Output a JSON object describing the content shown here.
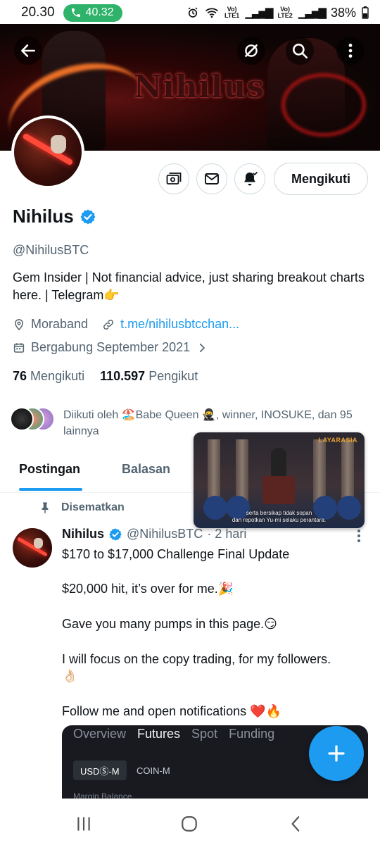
{
  "status_bar": {
    "time": "20.30",
    "call_timer": "40.32",
    "sim1": "Vo) LTE1",
    "sim2": "Vo) LTE2",
    "battery": "38%"
  },
  "header": {
    "banner_title": "Nihilus",
    "icons": [
      "back-arrow-icon",
      "grok-icon",
      "search-icon",
      "more-vertical-icon"
    ]
  },
  "profile": {
    "name": "Nihilus",
    "handle": "@NihilusBTC",
    "bio": "Gem Insider | Not financial advice, just sharing breakout charts here. | Telegram👉",
    "location": "Moraband",
    "website": "t.me/nihilusbtcchan...",
    "joined": "Bergabung September 2021",
    "following_count": "76",
    "following_label": "Mengikuti",
    "followers_count": "110.597",
    "followers_label": "Pengikut",
    "followed_by": "Diikuti oleh 🏖️Babe Queen 🥷, winner, INOSUKE, dan 95 lainnya",
    "follow_button": "Mengikuti",
    "verified_color": "#1d9bf0"
  },
  "tabs": [
    {
      "label": "Postingan",
      "active": true
    },
    {
      "label": "Balasan",
      "active": false
    }
  ],
  "pip_video": {
    "channel": "LAYARASIA",
    "subtitle_line1": "serta bersikap tidak sopan",
    "subtitle_line2": "dan repotkan Yu-mi selaku perantara."
  },
  "pinned_tweet": {
    "pinned_label": "Disematkan",
    "author": "Nihilus",
    "handle": "@NihilusBTC",
    "time": "· 2 hari",
    "lines": [
      "$170 to $17,000 Challenge Final Update",
      "$20,000 hit, it’s over for me.🎉",
      "Gave you many pumps in this page.😏",
      "I will focus on the copy trading, for my followers.",
      "👌🏻",
      "Follow me and open notifications ❤️🔥"
    ],
    "image": {
      "tabs": [
        "Overview",
        "Futures",
        "Spot",
        "Funding"
      ],
      "active_tab": "Futures",
      "pill_active": "USDⓈ-M",
      "pill_inactive": "COIN-M",
      "bottom_text": "Margin Balance"
    }
  },
  "fab_icon": "plus-icon",
  "nav_bar": [
    "recent-apps-icon",
    "home-icon",
    "back-icon"
  ],
  "colors": {
    "accent": "#1d9bf0",
    "call_pill": "#2fb36a",
    "text_primary": "#0f1419",
    "text_secondary": "#536471"
  }
}
